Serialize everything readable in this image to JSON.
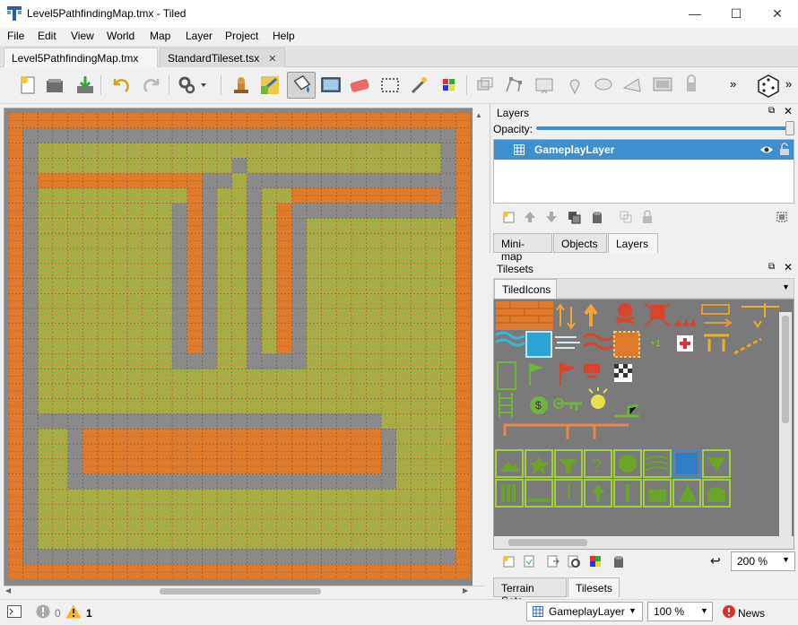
{
  "window": {
    "title": "Level5PathfindingMap.tmx - Tiled",
    "minimize": "—",
    "maximize": "☐",
    "close": "✕"
  },
  "menu": [
    "File",
    "Edit",
    "View",
    "World",
    "Map",
    "Layer",
    "Project",
    "Help"
  ],
  "tabs": [
    {
      "label": "Level5PathfindingMap.tmx",
      "active": true
    },
    {
      "label": "StandardTileset.tsx",
      "active": false
    }
  ],
  "toolbar": {
    "overflow_left": "»",
    "overflow_right": "»",
    "icons": [
      "new-map-icon",
      "open-icon",
      "save-icon",
      "undo-icon",
      "redo-icon",
      "commands-icon",
      "stamp-brush-icon",
      "terrain-brush-icon",
      "bucket-fill-icon",
      "shape-fill-icon",
      "eraser-icon",
      "rect-select-icon",
      "magic-wand-icon",
      "select-same-tile-icon",
      "select-objects-icon",
      "edit-polygons-icon",
      "insert-rectangle-icon",
      "insert-point-icon",
      "insert-ellipse-icon",
      "insert-polygon-icon",
      "insert-tile-icon",
      "insert-text-icon",
      "random-mode-icon"
    ]
  },
  "layers_panel": {
    "title": "Layers",
    "opacity_label": "Opacity:",
    "layer_name": "GameplayLayer",
    "tabs": [
      "Mini-map",
      "Objects",
      "Layers"
    ],
    "active_tab": "Layers"
  },
  "tilesets_panel": {
    "title": "Tilesets",
    "tileset_tab": "TiledIcons",
    "zoom": "200 %",
    "tabs": [
      "Terrain Sets",
      "Tilesets"
    ],
    "active_tab": "Tilesets"
  },
  "status": {
    "errors": "0",
    "warnings": "1",
    "layer": "GameplayLayer",
    "zoom": "100 %",
    "news": "News"
  },
  "colors": {
    "orange": "#e07a2b",
    "grey": "#8a8a8a",
    "green": "#9fbf2f",
    "highlight": "#3e8fd0"
  },
  "map": {
    "cols": 31,
    "rows": 31,
    "legend": {
      "O": "orange-wall",
      "G": "grey-path",
      "V": "grass"
    },
    "tiles": [
      "OOOOOOOOOOOOOOOOOOOOOOOOOOOOOOO",
      "OGGGGGGGGGGGGGGGGGGGGGGGGGGGGGO",
      "OGVVVVVVVVVVVVVVVVVVVVVVVVVVVGO",
      "OGVVVVVVVVVVVVVGVVVVVVVVVVVVVGO",
      "OGOOOOOOOOOOOGGVGGGGGGGGGGGGGGO",
      "OGVVVVVVVVVVOGVVGVVOOOOOOOOOOGO",
      "OGVVVVVVVVVGOGVVGVOGGGGGGGGGGGO",
      "OGVVVVVVVVVGOGVVGVOGVVVVVVVVVVO",
      "OGVVVVVVVVVGOGVVGVOGVVVVVVVVVVO",
      "OGVVVVVVVVVGOGVVGVOGVVVVVVVVVVO",
      "OGVVVVVVVVVGOGVVGVOGVVVVVVVVVVO",
      "OGVVVVVVVVVGOGVVGVOGVVVVVVVVVVO",
      "OGVVVVVVVVVGOGVVGVOGVVVVVVVVVVO",
      "OGVVVVVVVVVGOGVVGVOGVVVVVVVVVVO",
      "OGVVVVVVVVVGOGVVGVOGVVVVVVVVVVO",
      "OGVVVVVVVVVGOGVVGVOGVVVVVVVVVVO",
      "OGVVVVVVVVVGGGVVGGGGVVVVVVVVVVO",
      "OGVVVVVVVVVVVVVVVVVVVVVVVVVVVVO",
      "OGVVVVVVVVVVVVVVVVVVVVVVVVVVVVO",
      "OGVVVVVVVVVVVVVVVVVVVVVVVVVVVVO",
      "OGGGGGGGGGGGGGGGGGGGGGGGGVVVVVO",
      "OGVVGOOOOOOOOOOOOOOOOOOOOGVVVVO",
      "OGVVGOOOOOOOOOOOOOOOOOOOOGVVVVO",
      "OGVVGOOOOOOOOOOOOOOOOOOOOGVVVVO",
      "OGVVGGGGGGGGGGGGGGGGGGGGGGVVVVO",
      "OGVVVVVVVVVVVVVVVVVVVVVVVVVVVVO",
      "OGVVVVVVVVVVVVVVVVVVVVVVVVVVVVO",
      "OGVVVVVVVVVVVVVVVVVVVVVVVVVVVVO",
      "OGVVVVVVVVVVVVVVVVVVVVVVVVVVVVO",
      "OGGGGGGGGGGGGGGGGGGGGGGGGGGGGGO",
      "OOOOOOOOOOOOOOOOOOOOOOOOOOOOOOO"
    ]
  }
}
